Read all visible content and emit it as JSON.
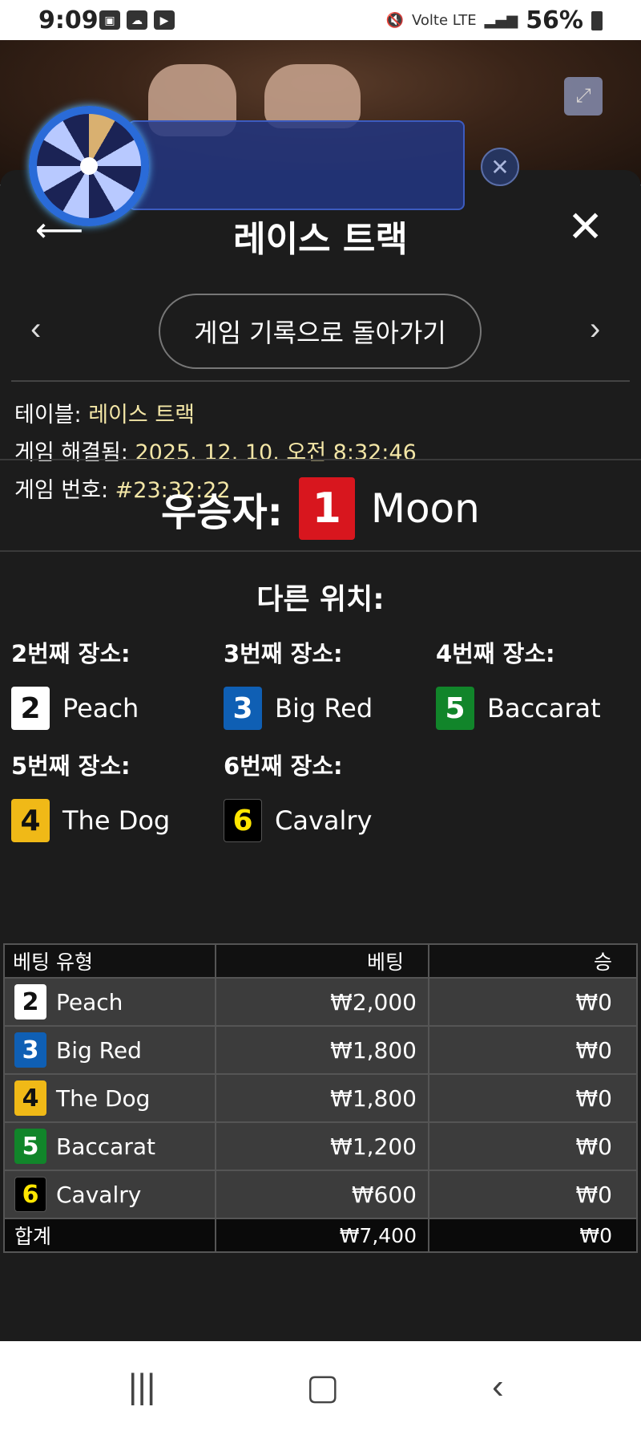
{
  "status_bar": {
    "time": "9:09",
    "icons": [
      "image-icon",
      "cloud-icon",
      "youtube-icon"
    ],
    "signal_text": "Volte LTE",
    "battery": "56%"
  },
  "header": {
    "title": "레이스 트랙",
    "back_icon": "arrow-left-icon",
    "close_icon": "close-icon"
  },
  "nav": {
    "back_to_history_label": "게임 기록으로 돌아가기",
    "prev_icon": "chevron-left-icon",
    "next_icon": "chevron-right-icon"
  },
  "info": {
    "table_label": "테이블:",
    "table_value": "레이스 트랙",
    "resolved_label": "게임 해결됨:",
    "resolved_value": "2025. 12. 10. 오전 8:32:46",
    "game_no_label": "게임 번호:",
    "game_no_value": "#23:32:22"
  },
  "winner": {
    "label": "우승자:",
    "number": "1",
    "name": "Moon",
    "color": "#d8161e"
  },
  "other_positions": {
    "title": "다른 위치:",
    "places": [
      {
        "label": "2번째 장소:",
        "number": "2",
        "name": "Peach",
        "color_class": "c2"
      },
      {
        "label": "3번째 장소:",
        "number": "3",
        "name": "Big Red",
        "color_class": "c3"
      },
      {
        "label": "4번째 장소:",
        "number": "5",
        "name": "Baccarat",
        "color_class": "c5"
      },
      {
        "label": "5번째 장소:",
        "number": "4",
        "name": "The Dog",
        "color_class": "c4"
      },
      {
        "label": "6번째 장소:",
        "number": "6",
        "name": "Cavalry",
        "color_class": "c6"
      }
    ]
  },
  "bets_table": {
    "headers": [
      "베팅 유형",
      "베팅",
      "승"
    ],
    "rows": [
      {
        "number": "2",
        "name": "Peach",
        "bet": "₩2,000",
        "win": "₩0"
      },
      {
        "number": "3",
        "name": "Big Red",
        "bet": "₩1,800",
        "win": "₩0"
      },
      {
        "number": "4",
        "name": "The Dog",
        "bet": "₩1,800",
        "win": "₩0"
      },
      {
        "number": "5",
        "name": "Baccarat",
        "bet": "₩1,200",
        "win": "₩0"
      },
      {
        "number": "6",
        "name": "Cavalry",
        "bet": "₩600",
        "win": "₩0"
      }
    ],
    "total": {
      "label": "합계",
      "bet": "₩7,400",
      "win": "₩0"
    }
  },
  "system_nav": {
    "recents_icon": "recent-apps-icon",
    "home_icon": "home-icon",
    "back_icon": "back-icon"
  }
}
